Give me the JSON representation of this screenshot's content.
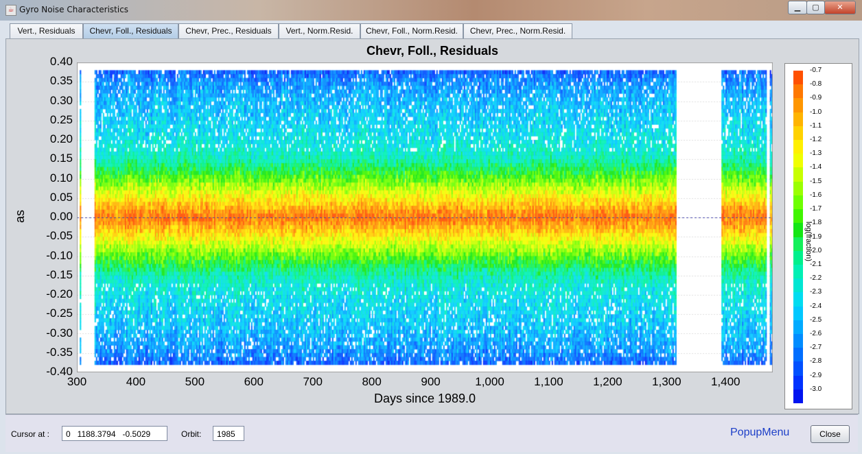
{
  "window": {
    "title": "Gyro Noise Characteristics",
    "icon": "java-icon",
    "controls": [
      "minimize",
      "maximize",
      "close"
    ]
  },
  "tabs": [
    {
      "label": "Vert., Residuals",
      "selected": false
    },
    {
      "label": "Chevr, Foll., Residuals",
      "selected": true
    },
    {
      "label": "Chevr, Prec., Residuals",
      "selected": false
    },
    {
      "label": "Vert., Norm.Resid.",
      "selected": false
    },
    {
      "label": "Chevr, Foll., Norm.Resid.",
      "selected": false
    },
    {
      "label": "Chevr, Prec., Norm.Resid.",
      "selected": false
    }
  ],
  "chart_data": {
    "type": "heatmap",
    "title": "Chevr, Foll., Residuals",
    "xlabel": "Days since 1989.0",
    "ylabel": "as",
    "xlim": [
      300,
      1480
    ],
    "ylim": [
      -0.4,
      0.4
    ],
    "xticks": [
      "300",
      "400",
      "500",
      "600",
      "700",
      "800",
      "900",
      "1,000",
      "1,100",
      "1,200",
      "1,300",
      "1,400"
    ],
    "yticks": [
      "0.40",
      "0.35",
      "0.30",
      "0.25",
      "0.20",
      "0.15",
      "0.10",
      "0.05",
      "0.00",
      "-0.05",
      "-0.10",
      "-0.15",
      "-0.20",
      "-0.25",
      "-0.30",
      "-0.35",
      "-0.40"
    ],
    "data_x_ranges": [
      [
        305,
        307
      ],
      [
        330,
        1316
      ],
      [
        1393,
        1468
      ],
      [
        1475,
        1480
      ]
    ],
    "profile": {
      "y": [
        0.0,
        0.05,
        0.1,
        0.15,
        0.2,
        0.25,
        0.3,
        0.35,
        0.4
      ],
      "log_fraction": [
        -0.75,
        -1.2,
        -1.65,
        -2.1,
        -2.25,
        -2.35,
        -2.45,
        -2.6,
        -2.9
      ]
    },
    "zero_line": true,
    "colorbar": {
      "title": "log(fraction)",
      "labels": [
        "-0.7",
        "-0.8",
        "-0.9",
        "-1.0",
        "-1.1",
        "-1.2",
        "-1.3",
        "-1.4",
        "-1.5",
        "-1.6",
        "-1.7",
        "-1.8",
        "-1.9",
        "-2.0",
        "-2.1",
        "-2.2",
        "-2.3",
        "-2.4",
        "-2.5",
        "-2.6",
        "-2.7",
        "-2.8",
        "-2.9",
        "-3.0"
      ],
      "colors": [
        "#ff5000",
        "#ff7800",
        "#ff9600",
        "#ffb400",
        "#ffd200",
        "#fff000",
        "#f0ff00",
        "#c8ff00",
        "#9bff00",
        "#6eff00",
        "#41f500",
        "#14e614",
        "#14f05a",
        "#00f08c",
        "#00f0b4",
        "#00e6d2",
        "#00dcf0",
        "#00c8ff",
        "#00aaff",
        "#008cff",
        "#006eff",
        "#0050ff",
        "#0032ff",
        "#0014f0"
      ]
    }
  },
  "bottom_bar": {
    "cursor_label": "Cursor at :",
    "cursor_value": "0   1188.3794   -0.5029",
    "orbit_label": "Orbit:",
    "orbit_value": "1985",
    "popup_label": "PopupMenu",
    "close_label": "Close"
  }
}
